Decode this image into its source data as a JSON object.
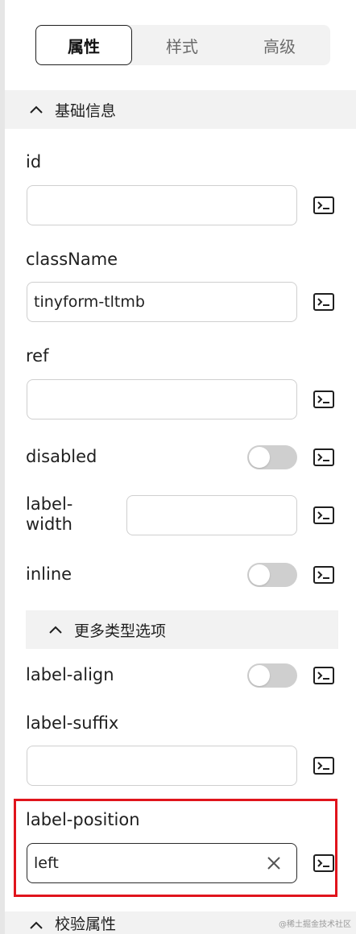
{
  "tabs": [
    {
      "label": "属性",
      "active": true
    },
    {
      "label": "样式",
      "active": false
    },
    {
      "label": "高级",
      "active": false
    }
  ],
  "sections": {
    "basic": {
      "title": "基础信息",
      "expanded": true
    },
    "more_types": {
      "title": "更多类型选项",
      "expanded": true
    },
    "validation": {
      "title": "校验属性"
    }
  },
  "properties": {
    "id": {
      "label": "id",
      "value": ""
    },
    "className": {
      "label": "className",
      "value": "tinyform-tltmb"
    },
    "ref": {
      "label": "ref",
      "value": ""
    },
    "disabled": {
      "label": "disabled",
      "checked": false
    },
    "label_width": {
      "label_line1": "label-",
      "label_line2": "width",
      "value": ""
    },
    "inline": {
      "label": "inline",
      "checked": false
    },
    "label_align": {
      "label": "label-align",
      "checked": false
    },
    "label_suffix": {
      "label": "label-suffix",
      "value": ""
    },
    "label_position": {
      "label": "label-position",
      "value": "left"
    }
  },
  "icons": {
    "expression": "terminal-icon",
    "collapse": "chevron-up-icon",
    "clear": "close-icon"
  },
  "colors": {
    "section_bg": "#f2f2f2",
    "toggle_off": "#cfcfcf",
    "highlight_border": "#e0141c"
  },
  "watermark": "@稀土掘金技术社区"
}
